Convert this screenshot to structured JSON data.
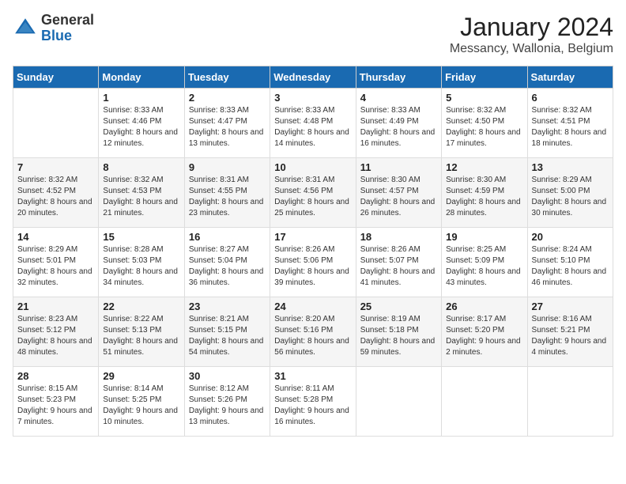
{
  "logo": {
    "general": "General",
    "blue": "Blue"
  },
  "header": {
    "month": "January 2024",
    "location": "Messancy, Wallonia, Belgium"
  },
  "weekdays": [
    "Sunday",
    "Monday",
    "Tuesday",
    "Wednesday",
    "Thursday",
    "Friday",
    "Saturday"
  ],
  "weeks": [
    [
      {
        "day": "",
        "sunrise": "",
        "sunset": "",
        "daylight": ""
      },
      {
        "day": "1",
        "sunrise": "Sunrise: 8:33 AM",
        "sunset": "Sunset: 4:46 PM",
        "daylight": "Daylight: 8 hours and 12 minutes."
      },
      {
        "day": "2",
        "sunrise": "Sunrise: 8:33 AM",
        "sunset": "Sunset: 4:47 PM",
        "daylight": "Daylight: 8 hours and 13 minutes."
      },
      {
        "day": "3",
        "sunrise": "Sunrise: 8:33 AM",
        "sunset": "Sunset: 4:48 PM",
        "daylight": "Daylight: 8 hours and 14 minutes."
      },
      {
        "day": "4",
        "sunrise": "Sunrise: 8:33 AM",
        "sunset": "Sunset: 4:49 PM",
        "daylight": "Daylight: 8 hours and 16 minutes."
      },
      {
        "day": "5",
        "sunrise": "Sunrise: 8:32 AM",
        "sunset": "Sunset: 4:50 PM",
        "daylight": "Daylight: 8 hours and 17 minutes."
      },
      {
        "day": "6",
        "sunrise": "Sunrise: 8:32 AM",
        "sunset": "Sunset: 4:51 PM",
        "daylight": "Daylight: 8 hours and 18 minutes."
      }
    ],
    [
      {
        "day": "7",
        "sunrise": "Sunrise: 8:32 AM",
        "sunset": "Sunset: 4:52 PM",
        "daylight": "Daylight: 8 hours and 20 minutes."
      },
      {
        "day": "8",
        "sunrise": "Sunrise: 8:32 AM",
        "sunset": "Sunset: 4:53 PM",
        "daylight": "Daylight: 8 hours and 21 minutes."
      },
      {
        "day": "9",
        "sunrise": "Sunrise: 8:31 AM",
        "sunset": "Sunset: 4:55 PM",
        "daylight": "Daylight: 8 hours and 23 minutes."
      },
      {
        "day": "10",
        "sunrise": "Sunrise: 8:31 AM",
        "sunset": "Sunset: 4:56 PM",
        "daylight": "Daylight: 8 hours and 25 minutes."
      },
      {
        "day": "11",
        "sunrise": "Sunrise: 8:30 AM",
        "sunset": "Sunset: 4:57 PM",
        "daylight": "Daylight: 8 hours and 26 minutes."
      },
      {
        "day": "12",
        "sunrise": "Sunrise: 8:30 AM",
        "sunset": "Sunset: 4:59 PM",
        "daylight": "Daylight: 8 hours and 28 minutes."
      },
      {
        "day": "13",
        "sunrise": "Sunrise: 8:29 AM",
        "sunset": "Sunset: 5:00 PM",
        "daylight": "Daylight: 8 hours and 30 minutes."
      }
    ],
    [
      {
        "day": "14",
        "sunrise": "Sunrise: 8:29 AM",
        "sunset": "Sunset: 5:01 PM",
        "daylight": "Daylight: 8 hours and 32 minutes."
      },
      {
        "day": "15",
        "sunrise": "Sunrise: 8:28 AM",
        "sunset": "Sunset: 5:03 PM",
        "daylight": "Daylight: 8 hours and 34 minutes."
      },
      {
        "day": "16",
        "sunrise": "Sunrise: 8:27 AM",
        "sunset": "Sunset: 5:04 PM",
        "daylight": "Daylight: 8 hours and 36 minutes."
      },
      {
        "day": "17",
        "sunrise": "Sunrise: 8:26 AM",
        "sunset": "Sunset: 5:06 PM",
        "daylight": "Daylight: 8 hours and 39 minutes."
      },
      {
        "day": "18",
        "sunrise": "Sunrise: 8:26 AM",
        "sunset": "Sunset: 5:07 PM",
        "daylight": "Daylight: 8 hours and 41 minutes."
      },
      {
        "day": "19",
        "sunrise": "Sunrise: 8:25 AM",
        "sunset": "Sunset: 5:09 PM",
        "daylight": "Daylight: 8 hours and 43 minutes."
      },
      {
        "day": "20",
        "sunrise": "Sunrise: 8:24 AM",
        "sunset": "Sunset: 5:10 PM",
        "daylight": "Daylight: 8 hours and 46 minutes."
      }
    ],
    [
      {
        "day": "21",
        "sunrise": "Sunrise: 8:23 AM",
        "sunset": "Sunset: 5:12 PM",
        "daylight": "Daylight: 8 hours and 48 minutes."
      },
      {
        "day": "22",
        "sunrise": "Sunrise: 8:22 AM",
        "sunset": "Sunset: 5:13 PM",
        "daylight": "Daylight: 8 hours and 51 minutes."
      },
      {
        "day": "23",
        "sunrise": "Sunrise: 8:21 AM",
        "sunset": "Sunset: 5:15 PM",
        "daylight": "Daylight: 8 hours and 54 minutes."
      },
      {
        "day": "24",
        "sunrise": "Sunrise: 8:20 AM",
        "sunset": "Sunset: 5:16 PM",
        "daylight": "Daylight: 8 hours and 56 minutes."
      },
      {
        "day": "25",
        "sunrise": "Sunrise: 8:19 AM",
        "sunset": "Sunset: 5:18 PM",
        "daylight": "Daylight: 8 hours and 59 minutes."
      },
      {
        "day": "26",
        "sunrise": "Sunrise: 8:17 AM",
        "sunset": "Sunset: 5:20 PM",
        "daylight": "Daylight: 9 hours and 2 minutes."
      },
      {
        "day": "27",
        "sunrise": "Sunrise: 8:16 AM",
        "sunset": "Sunset: 5:21 PM",
        "daylight": "Daylight: 9 hours and 4 minutes."
      }
    ],
    [
      {
        "day": "28",
        "sunrise": "Sunrise: 8:15 AM",
        "sunset": "Sunset: 5:23 PM",
        "daylight": "Daylight: 9 hours and 7 minutes."
      },
      {
        "day": "29",
        "sunrise": "Sunrise: 8:14 AM",
        "sunset": "Sunset: 5:25 PM",
        "daylight": "Daylight: 9 hours and 10 minutes."
      },
      {
        "day": "30",
        "sunrise": "Sunrise: 8:12 AM",
        "sunset": "Sunset: 5:26 PM",
        "daylight": "Daylight: 9 hours and 13 minutes."
      },
      {
        "day": "31",
        "sunrise": "Sunrise: 8:11 AM",
        "sunset": "Sunset: 5:28 PM",
        "daylight": "Daylight: 9 hours and 16 minutes."
      },
      {
        "day": "",
        "sunrise": "",
        "sunset": "",
        "daylight": ""
      },
      {
        "day": "",
        "sunrise": "",
        "sunset": "",
        "daylight": ""
      },
      {
        "day": "",
        "sunrise": "",
        "sunset": "",
        "daylight": ""
      }
    ]
  ]
}
